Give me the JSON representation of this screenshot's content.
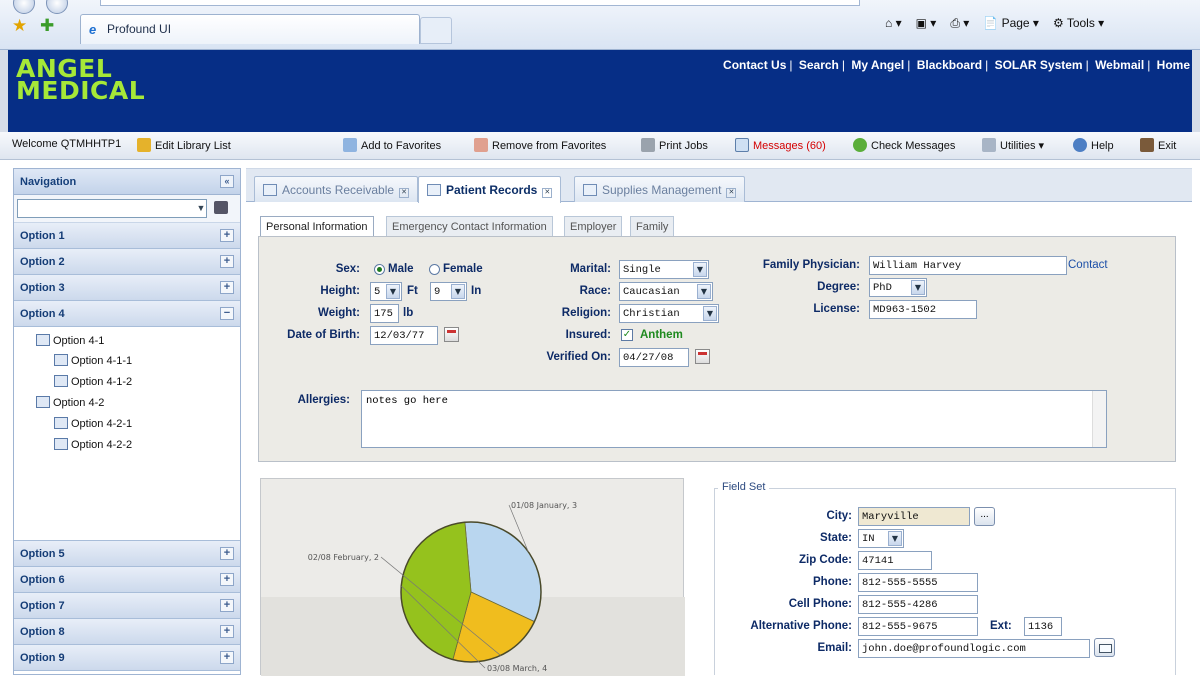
{
  "browser": {
    "tab_title": "Profound UI",
    "commands": {
      "page": "Page",
      "tools": "Tools"
    }
  },
  "header": {
    "logo_line1": "ANGEL",
    "logo_line2": "MEDICAL",
    "links": [
      "Contact Us",
      "Search",
      "My Angel",
      "Blackboard",
      "SOLAR System",
      "Webmail",
      "Home"
    ]
  },
  "toolbar": {
    "welcome": "Welcome QTMHHTP1",
    "edit_library_list": "Edit Library List",
    "add_favorites": "Add to Favorites",
    "remove_favorites": "Remove from Favorites",
    "print_jobs": "Print Jobs",
    "messages": "Messages (60)",
    "check_messages": "Check Messages",
    "utilities": "Utilities",
    "help": "Help",
    "exit": "Exit"
  },
  "nav": {
    "title": "Navigation",
    "options_top": [
      "Option 1",
      "Option 2",
      "Option 3",
      "Option 4"
    ],
    "tree": [
      "Option 4-1",
      "Option 4-1-1",
      "Option 4-1-2",
      "Option 4-2",
      "Option 4-2-1",
      "Option 4-2-2"
    ],
    "options_bottom": [
      "Option 5",
      "Option 6",
      "Option 7",
      "Option 8",
      "Option 9"
    ]
  },
  "main_tabs": [
    "Accounts Receivable",
    "Patient Records",
    "Supplies Management"
  ],
  "sub_tabs": [
    "Personal Information",
    "Emergency Contact Information",
    "Employer",
    "Family"
  ],
  "form": {
    "sex_label": "Sex:",
    "sex_male": "Male",
    "sex_female": "Female",
    "height_label": "Height:",
    "height_ft": "5",
    "ft_unit": "Ft",
    "height_in": "9",
    "in_unit": "In",
    "weight_label": "Weight:",
    "weight": "175",
    "weight_unit": "lb",
    "dob_label": "Date of Birth:",
    "dob": "12/03/77",
    "marital_label": "Marital:",
    "marital": "Single",
    "race_label": "Race:",
    "race": "Caucasian",
    "religion_label": "Religion:",
    "religion": "Christian",
    "insured_label": "Insured:",
    "insurer": "Anthem",
    "verified_label": "Verified On:",
    "verified": "04/27/08",
    "physician_label": "Family Physician:",
    "physician": "William Harvey",
    "contact_link": "Contact",
    "degree_label": "Degree:",
    "degree": "PhD",
    "license_label": "License:",
    "license": "MD963-1502",
    "allergies_label": "Allergies:",
    "allergies": "notes go here"
  },
  "chart_data": {
    "type": "pie",
    "categories": [
      "01/08 January",
      "02/08 February",
      "03/08 March"
    ],
    "values": [
      3,
      2,
      4
    ],
    "labels": [
      "01/08 January, 3",
      "02/08 February, 2",
      "03/08 March, 4"
    ],
    "colors": [
      "#b9d6ef",
      "#f0bd1e",
      "#95c21d"
    ]
  },
  "fieldset": {
    "legend": "Field Set",
    "city_label": "City:",
    "city": "Maryville",
    "state_label": "State:",
    "state": "IN",
    "zip_label": "Zip Code:",
    "zip": "47141",
    "phone_label": "Phone:",
    "phone": "812-555-5555",
    "cell_label": "Cell Phone:",
    "cell": "812-555-4286",
    "alt_label": "Alternative Phone:",
    "alt": "812-555-9675",
    "ext_label": "Ext:",
    "ext": "1136",
    "email_label": "Email:",
    "email": "john.doe@profoundlogic.com"
  }
}
